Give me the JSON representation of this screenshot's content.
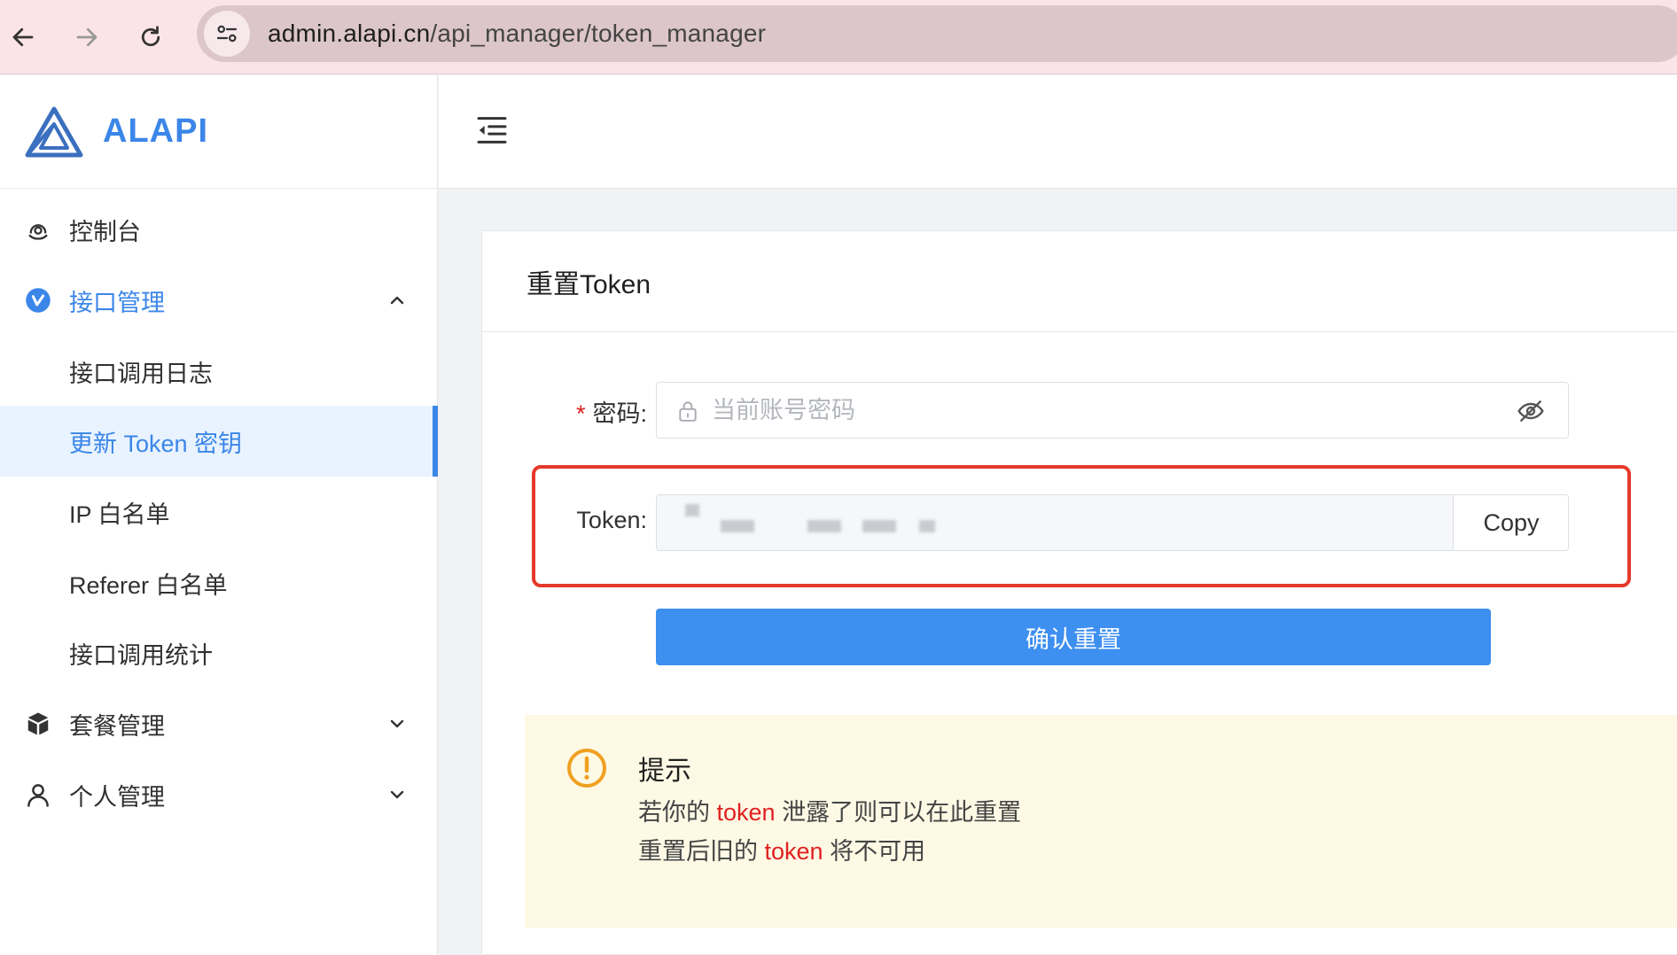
{
  "browser": {
    "url_host": "admin.alapi.cn",
    "url_path": "/api_manager/token_manager"
  },
  "sidebar": {
    "logo_text": "ALAPI",
    "items": [
      {
        "label": "控制台"
      },
      {
        "label": "接口管理"
      },
      {
        "label": "接口调用日志"
      },
      {
        "label": "更新 Token 密钥"
      },
      {
        "label": "IP 白名单"
      },
      {
        "label": "Referer 白名单"
      },
      {
        "label": "接口调用统计"
      },
      {
        "label": "套餐管理"
      },
      {
        "label": "个人管理"
      }
    ]
  },
  "card": {
    "title": "重置Token",
    "password_label": "密码",
    "password_required_mark": "*",
    "password_placeholder": "当前账号密码",
    "token_label": "Token",
    "copy_label": "Copy",
    "confirm_label": "确认重置"
  },
  "tip": {
    "title": "提示",
    "line1_prefix": "若你的",
    "line1_highlight": "token",
    "line1_suffix": "泄露了则可以在此重置",
    "line2_prefix": "重置后旧的",
    "line2_highlight": "token",
    "line2_suffix": "将不可用"
  },
  "colors": {
    "accent": "#3b86e8",
    "highlight_border": "#e53a2a",
    "tip_background": "#fdf9e5",
    "warning": "#f0a020"
  }
}
